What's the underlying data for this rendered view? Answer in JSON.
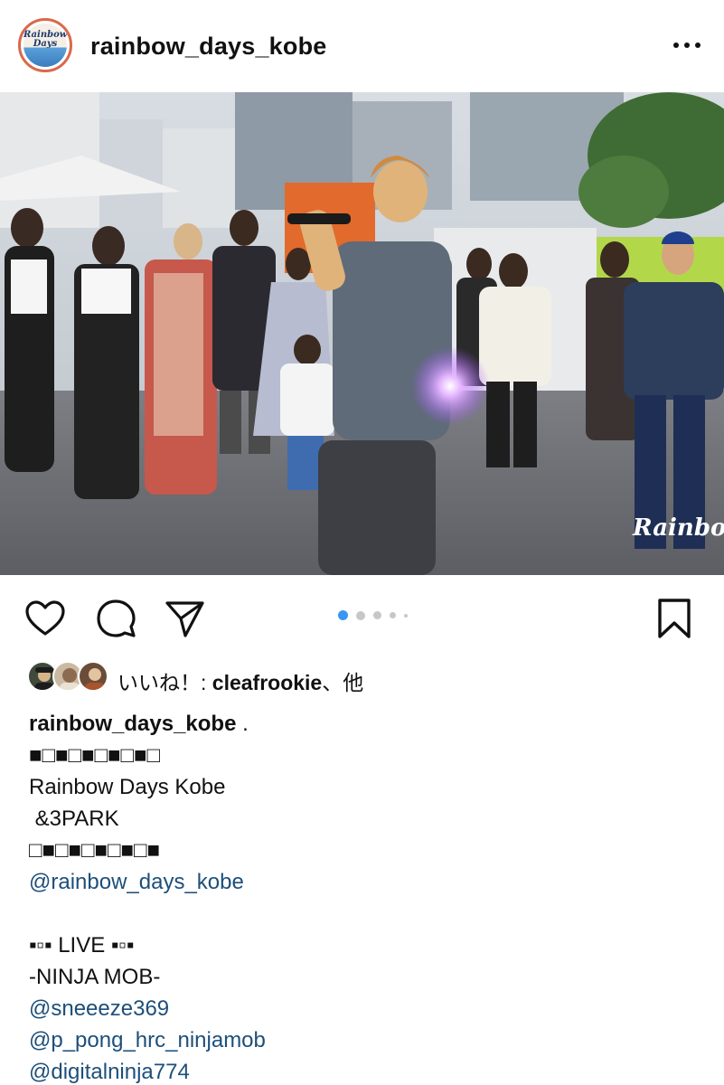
{
  "post": {
    "username": "rainbow_days_kobe",
    "avatar_text": "Rainbow Days",
    "more_icon": "more-horizontal-icon",
    "photo_watermark": "Rainbow Days",
    "carousel": {
      "count": 5,
      "active_index": 1
    }
  },
  "likes": {
    "prefix": "いいね！: ",
    "user": "cleafrookie",
    "suffix": "、他"
  },
  "caption": {
    "author": "rainbow_days_kobe",
    "first_line_rest": " .",
    "lines": [
      "■□■□■□■□■□",
      "Rainbow Days Kobe",
      " &3PARK",
      "□■□■□■□■□■"
    ],
    "mention_1": "@rainbow_days_kobe",
    "live_line": "▪▫▪ LIVE ▪▫▪",
    "group": "-NINJA MOB-",
    "mentions": [
      "@sneeeze369",
      "@p_pong_hrc_ninjamob",
      "@digitalninja774"
    ]
  },
  "colors": {
    "avatar_ring": "#d9694a",
    "mention": "#1d4f7a",
    "carousel_active": "#3897f0"
  }
}
